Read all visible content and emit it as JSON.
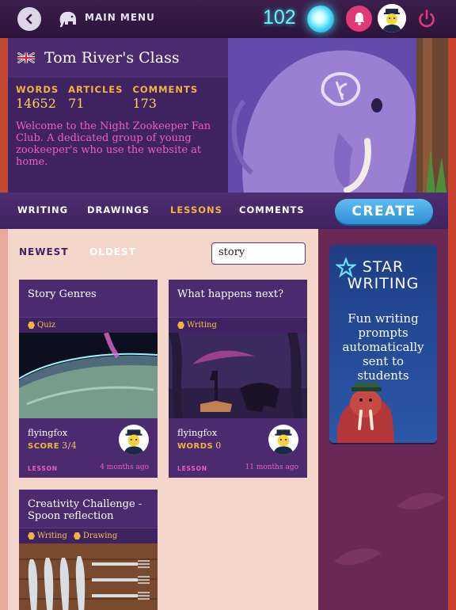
{
  "topbar": {
    "main_menu_label": "Main Menu",
    "orb_count": "102"
  },
  "class": {
    "title": "Tom River's Class",
    "stats": [
      {
        "label": "Words",
        "value": "14652"
      },
      {
        "label": "Articles",
        "value": "71"
      },
      {
        "label": "Comments",
        "value": "173"
      }
    ],
    "welcome": "Welcome to the Night Zookeeper Fan Club. A dedicated group of young zookeeper's who use the website at home."
  },
  "tabs": [
    {
      "label": "Writing",
      "active": false
    },
    {
      "label": "Drawings",
      "active": false
    },
    {
      "label": "Lessons",
      "active": true
    },
    {
      "label": "Comments",
      "active": false
    }
  ],
  "create_label": "Create",
  "sort": {
    "newest": "Newest",
    "oldest": "Oldest"
  },
  "search": {
    "value": "story"
  },
  "cards": [
    {
      "title": "Story Genres",
      "tags": [
        "Quiz"
      ],
      "user": "flyingfox",
      "metric_label": "Score",
      "metric_value": "3/4",
      "type": "Lesson",
      "time": "4 months ago"
    },
    {
      "title": "What happens next?",
      "tags": [
        "Writing"
      ],
      "user": "flyingfox",
      "metric_label": "Words",
      "metric_value": "0",
      "type": "Lesson",
      "time": "11 months ago"
    },
    {
      "title": "Creativity Challenge - Spoon reflection",
      "tags": [
        "Writing",
        "Drawing"
      ]
    }
  ],
  "ad": {
    "logo_line1": "STAR",
    "logo_line2": "WRITING",
    "text": "Fun writing prompts automatically sent to students"
  },
  "colors": {
    "accent_gold": "#f2b43e",
    "accent_pink": "#ee5fc0",
    "panel_purple": "#4c2a6f",
    "create_blue": "#3fa3e2",
    "orb_cyan": "#6cf0f7"
  }
}
